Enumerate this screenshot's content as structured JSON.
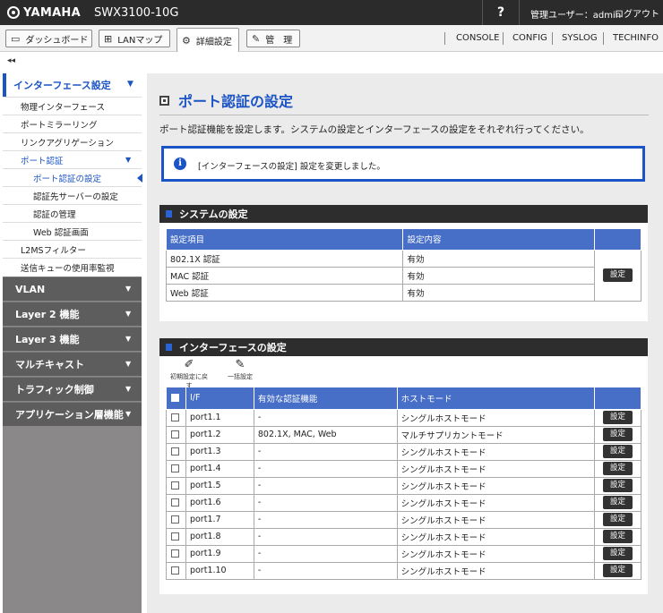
{
  "header": {
    "brand": "YAMAHA",
    "model": "SWX3100-10G",
    "help": "?",
    "user": "管理ユーザー：admin",
    "logout": "ログアウト"
  },
  "nav": {
    "tabs": [
      {
        "label": "ダッシュボード",
        "icon": "dashboard-icon"
      },
      {
        "label": "LANマップ",
        "icon": "lanmap-icon"
      },
      {
        "label": "詳細設定",
        "icon": "gear-icon"
      },
      {
        "label": "管　理",
        "icon": "wrench-icon"
      }
    ],
    "links": [
      "CONSOLE",
      "CONFIG",
      "SYSLOG",
      "TECHINFO"
    ]
  },
  "collapse_label": "◂◂",
  "sidebar": {
    "section_title": "インターフェース設定",
    "items": [
      "物理インターフェース",
      "ポートミラーリング",
      "リンクアグリゲーション",
      "ポート認証",
      "ポート認証の設定",
      "認証先サーバーの設定",
      "認証の管理",
      "Web 認証画面",
      "L2MSフィルター",
      "送信キューの使用率監視"
    ],
    "categories": [
      "VLAN",
      "Layer 2 機能",
      "Layer 3 機能",
      "マルチキャスト",
      "トラフィック制御",
      "アプリケーション層機能"
    ]
  },
  "main": {
    "title": "ポート認証の設定",
    "description": "ポート認証機能を設定します。システムの設定とインターフェースの設定をそれぞれ行ってください。",
    "notice": "[インターフェースの設定] 設定を変更しました。",
    "system": {
      "title": "システムの設定",
      "headers": [
        "設定項目",
        "設定内容"
      ],
      "rows": [
        {
          "item": "802.1X 認証",
          "value": "有効"
        },
        {
          "item": "MAC 認証",
          "value": "有効"
        },
        {
          "item": "Web 認証",
          "value": "有効"
        }
      ],
      "button": "設定"
    },
    "interface": {
      "title": "インターフェースの設定",
      "tool_reset": "初期設定に戻す",
      "tool_bulk": "一括設定",
      "headers": [
        "I/F",
        "有効な認証機能",
        "ホストモード"
      ],
      "button": "設定",
      "rows": [
        {
          "port": "port1.1",
          "auth": "-",
          "mode": "シングルホストモード"
        },
        {
          "port": "port1.2",
          "auth": "802.1X, MAC, Web",
          "mode": "マルチサプリカントモード"
        },
        {
          "port": "port1.3",
          "auth": "-",
          "mode": "シングルホストモード"
        },
        {
          "port": "port1.4",
          "auth": "-",
          "mode": "シングルホストモード"
        },
        {
          "port": "port1.5",
          "auth": "-",
          "mode": "シングルホストモード"
        },
        {
          "port": "port1.6",
          "auth": "-",
          "mode": "シングルホストモード"
        },
        {
          "port": "port1.7",
          "auth": "-",
          "mode": "シングルホストモード"
        },
        {
          "port": "port1.8",
          "auth": "-",
          "mode": "シングルホストモード"
        },
        {
          "port": "port1.9",
          "auth": "-",
          "mode": "シングルホストモード"
        },
        {
          "port": "port1.10",
          "auth": "-",
          "mode": "シングルホストモード"
        }
      ]
    }
  }
}
